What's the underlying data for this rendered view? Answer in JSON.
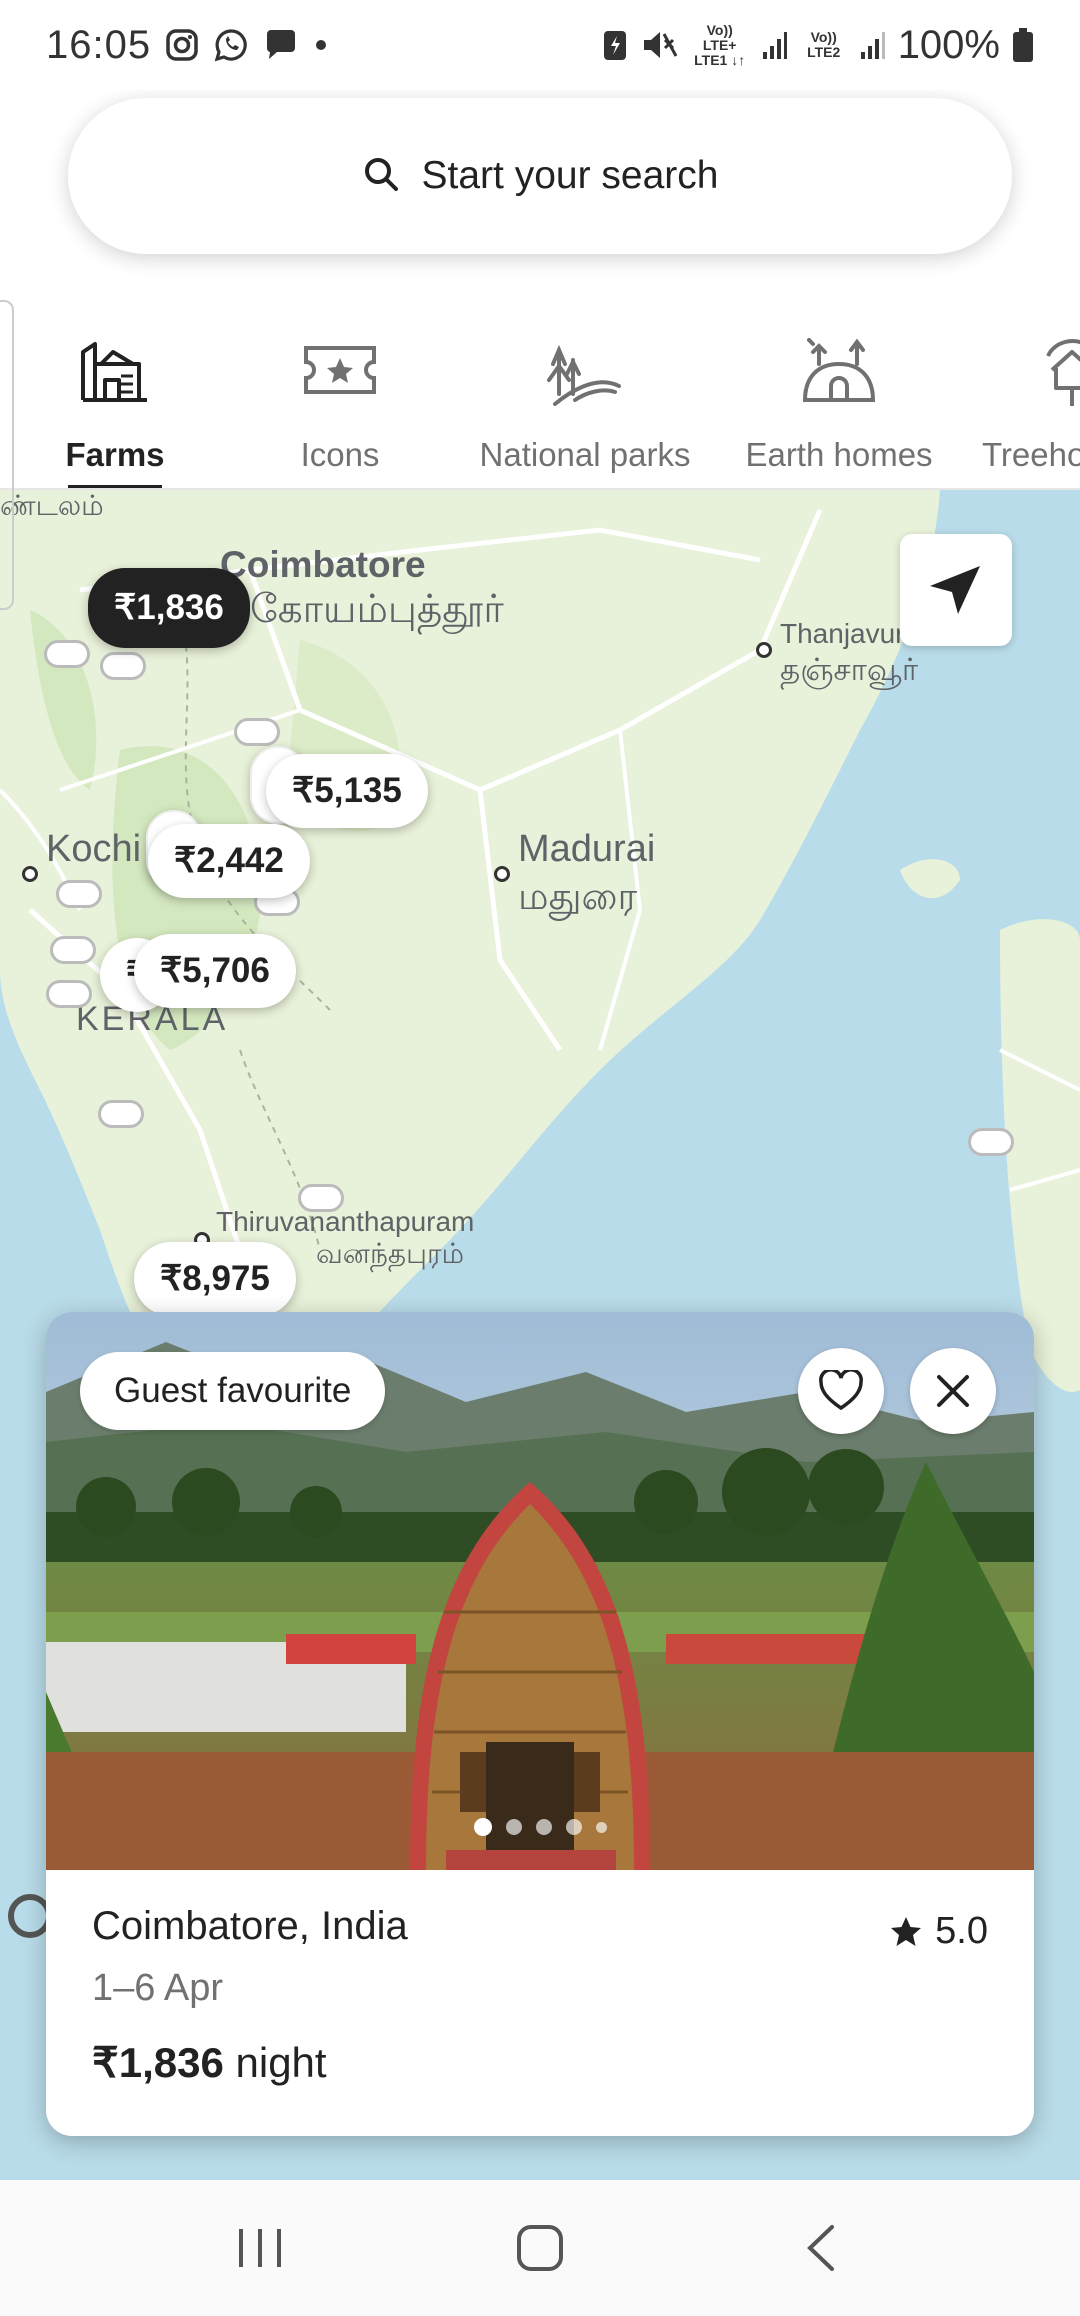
{
  "status_bar": {
    "time": "16:05",
    "network_1": "Vo)) LTE+ LTE1",
    "network_2": "Vo)) LTE2",
    "battery": "100%"
  },
  "search": {
    "placeholder_label": "Start your search"
  },
  "categories": [
    {
      "label": "Farms",
      "icon": "farm-icon",
      "active": true
    },
    {
      "label": "Icons",
      "icon": "ticket-star-icon",
      "active": false
    },
    {
      "label": "National parks",
      "icon": "national-park-icon",
      "active": false
    },
    {
      "label": "Earth homes",
      "icon": "earth-home-icon",
      "active": false
    },
    {
      "label": "Treeho",
      "icon": "treehouse-icon",
      "active": false
    }
  ],
  "map": {
    "labels": {
      "coimbatore": "Coimbatore",
      "coimbatore_ta": "கோயம்புத்தூர்",
      "thanjavur": "Thanjavur",
      "thanjavur_ta": "தஞ்சாவூர்",
      "madurai": "Madurai",
      "madurai_ta": "மதுரை",
      "kochi": "Kochi",
      "kerala": "KERALA",
      "thiruvananthapuram": "Thiruvananthapuram",
      "thiruvananthapuram_ta": "வனந்தபுரம்",
      "top_left_fragment": "ண்டலம்"
    },
    "price_pins": {
      "active": "₹1,836",
      "p1": "₹5,135",
      "p2": "₹2,442",
      "p3": "₹5,706",
      "p4": "₹8,975",
      "p5": "₹"
    }
  },
  "listing": {
    "badge": "Guest favourite",
    "title": "Coimbatore, India",
    "rating": "5.0",
    "dates": "1–6 Apr",
    "price": "₹1,836",
    "price_unit": "night",
    "photo_count": 5,
    "current_photo": 1
  }
}
